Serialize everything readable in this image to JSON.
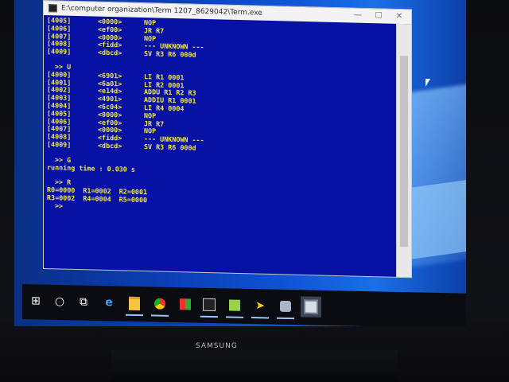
{
  "window": {
    "title": "E:\\computer organization\\Term 1207_8629042\\Term.exe",
    "controls": {
      "minimize": "—",
      "maximize": "☐",
      "close": "✕"
    }
  },
  "console": {
    "block1": [
      {
        "addr": "[4005]",
        "code": "<0000>",
        "ins": "NOP"
      },
      {
        "addr": "[4006]",
        "code": "<ef00>",
        "ins": "JR R7"
      },
      {
        "addr": "[4007]",
        "code": "<0000>",
        "ins": "NOP"
      },
      {
        "addr": "[4008]",
        "code": "<fidd>",
        "ins": "--- UNKNOWN ---"
      },
      {
        "addr": "[4009]",
        "code": "<dbcd>",
        "ins": "SV R3 R6 000d"
      }
    ],
    "prompt_u": ">> U",
    "block2": [
      {
        "addr": "[4000]",
        "code": "<6901>",
        "ins": "LI R1 0001"
      },
      {
        "addr": "[4001]",
        "code": "<6a01>",
        "ins": "LI R2 0001"
      },
      {
        "addr": "[4002]",
        "code": "<e14d>",
        "ins": "ADDU R1 R2 R3"
      },
      {
        "addr": "[4003]",
        "code": "<4901>",
        "ins": "ADDIU R1 0001"
      },
      {
        "addr": "[4004]",
        "code": "<6c04>",
        "ins": "LI R4 0004"
      },
      {
        "addr": "[4005]",
        "code": "<0000>",
        "ins": "NOP"
      },
      {
        "addr": "[4006]",
        "code": "<ef00>",
        "ins": "JR R7"
      },
      {
        "addr": "[4007]",
        "code": "<0000>",
        "ins": "NOP"
      },
      {
        "addr": "[4008]",
        "code": "<fidd>",
        "ins": "--- UNKNOWN ---"
      },
      {
        "addr": "[4009]",
        "code": "<dbcd>",
        "ins": "SV R3 R6 000d"
      }
    ],
    "prompt_g": ">> G",
    "running_time": "running time : 0.030 s",
    "prompt_r": ">> R",
    "regs_line1": "R0=0000  R1=0002  R2=0001",
    "regs_line2": "R3=0002  R4=0004  R5=0000",
    "prompt_end": ">>"
  },
  "taskbar": {
    "items": [
      {
        "name": "start",
        "icon": "windows-logo-icon",
        "glyph": "⊞"
      },
      {
        "name": "search",
        "icon": "search-circle-icon",
        "glyph": "○"
      },
      {
        "name": "task-view",
        "icon": "task-view-icon",
        "glyph": "⧉"
      },
      {
        "name": "edge",
        "icon": "edge-icon",
        "glyph": "e"
      },
      {
        "name": "file-explorer",
        "icon": "folder-icon",
        "glyph": ""
      },
      {
        "name": "chrome",
        "icon": "chrome-icon",
        "glyph": ""
      },
      {
        "name": "store",
        "icon": "store-icon",
        "glyph": ""
      },
      {
        "name": "terminal",
        "icon": "terminal-icon",
        "glyph": ""
      },
      {
        "name": "notepad",
        "icon": "notepad-icon",
        "glyph": ""
      },
      {
        "name": "arrow-app",
        "icon": "yellow-arrow-icon",
        "glyph": "➤"
      },
      {
        "name": "pin-app",
        "icon": "pin-icon",
        "glyph": ""
      },
      {
        "name": "running-term",
        "icon": "window-icon",
        "glyph": ""
      }
    ]
  },
  "monitor": {
    "brand": "SAMSUNG"
  },
  "colors": {
    "console_bg": "#0712a5",
    "console_text": "#f2e84a",
    "desktop": "#0b3fb8"
  }
}
